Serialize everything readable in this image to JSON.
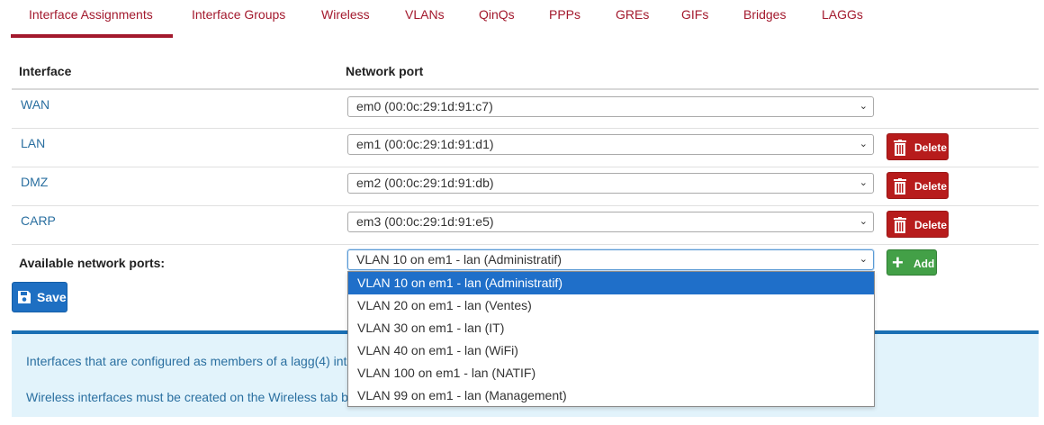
{
  "tabs": [
    {
      "label": "Interface Assignments",
      "active": true
    },
    {
      "label": "Interface Groups",
      "active": false
    },
    {
      "label": "Wireless",
      "active": false
    },
    {
      "label": "VLANs",
      "active": false
    },
    {
      "label": "QinQs",
      "active": false
    },
    {
      "label": "PPPs",
      "active": false
    },
    {
      "label": "GREs",
      "active": false
    },
    {
      "label": "GIFs",
      "active": false
    },
    {
      "label": "Bridges",
      "active": false
    },
    {
      "label": "LAGGs",
      "active": false
    }
  ],
  "table": {
    "headers": {
      "interface": "Interface",
      "network_port": "Network port"
    },
    "rows": [
      {
        "interface": "WAN",
        "port": "em0 (00:0c:29:1d:91:c7)",
        "delete_label": ""
      },
      {
        "interface": "LAN",
        "port": "em1 (00:0c:29:1d:91:d1)",
        "delete_label": "Delete"
      },
      {
        "interface": "DMZ",
        "port": "em2 (00:0c:29:1d:91:db)",
        "delete_label": "Delete"
      },
      {
        "interface": "CARP",
        "port": "em3 (00:0c:29:1d:91:e5)",
        "delete_label": "Delete"
      }
    ],
    "available": {
      "label": "Available network ports:",
      "selected": "VLAN 10 on em1 - lan (Administratif)",
      "add_label": "Add"
    }
  },
  "save_label": "Save",
  "dropdown_options": [
    "VLAN 10 on em1 - lan (Administratif)",
    "VLAN 20 on em1 - lan (Ventes)",
    "VLAN 30 on em1 - lan (IT)",
    "VLAN 40 on em1 - lan (WiFi)",
    "VLAN 100 on em1 - lan (NATIF)",
    "VLAN 99 on em1 - lan (Management)"
  ],
  "info": {
    "line1": "Interfaces that are configured as members of a lagg(4) int",
    "line2": "Wireless interfaces must be created on the Wireless tab b"
  },
  "colors": {
    "tab_text": "#a3192d",
    "link": "#2a6fa0",
    "delete": "#b71c1c",
    "add": "#43a047",
    "save": "#1e6fc2",
    "selected_option": "#1f6fc9",
    "info_bg": "#e2f3fb"
  },
  "icons": {
    "delete": "trash-icon",
    "add": "plus-icon",
    "save": "floppy-disk-icon",
    "dropdown": "chevron-down-icon"
  }
}
